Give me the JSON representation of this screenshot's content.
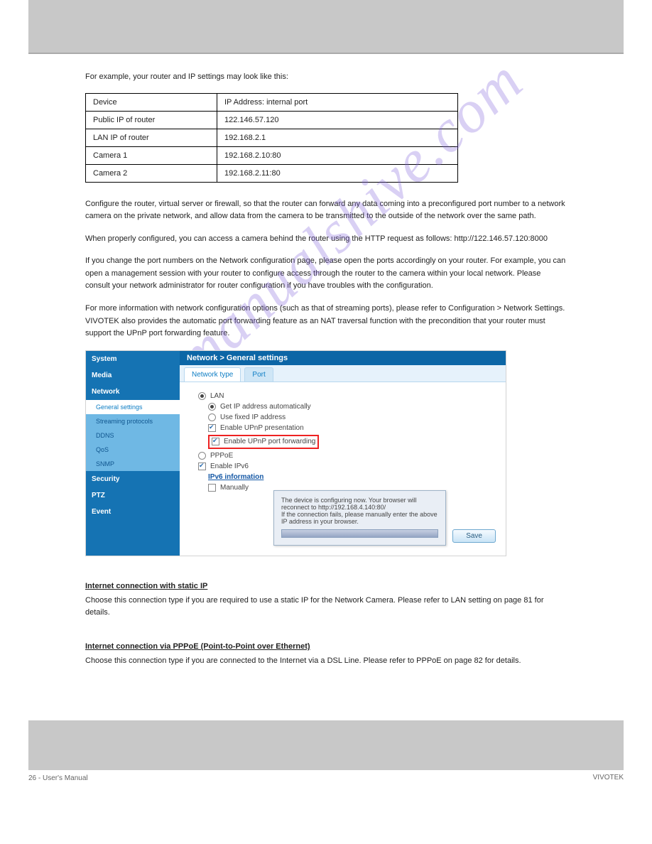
{
  "intro": "For example, your router and IP settings may look like this:",
  "table": {
    "rows": [
      [
        "Device",
        "IP Address: internal port"
      ],
      [
        "Public IP of router",
        "122.146.57.120"
      ],
      [
        "LAN IP of router",
        "192.168.2.1"
      ],
      [
        "Camera 1",
        "192.168.2.10:80"
      ],
      [
        "Camera 2",
        "192.168.2.11:80"
      ]
    ]
  },
  "para1": "Configure the router, virtual server or firewall, so that the router can forward any data coming into a preconfigured port number to a network camera on the private network, and allow data from the camera to be transmitted to the outside of the network over the same path.",
  "para2": "When properly configured, you can access a camera behind the router using the HTTP request as follows: http://122.146.57.120:8000",
  "para3": "If you change the port numbers on the Network configuration page, please open the ports accordingly on your router. For example, you can open a management session with your router to configure access through the router to the camera within your local network. Please consult your network administrator for router configuration if you have troubles with the configuration.",
  "para4": "For more information with network configuration options (such as that of streaming ports), please refer to Configuration > Network Settings. VIVOTEK also provides the automatic port forwarding feature as an NAT traversal function with the precondition that your router must support the UPnP port forwarding feature.",
  "screenshot": {
    "crumb": "Network  >  General settings",
    "sidebar": {
      "items": [
        "System",
        "Media",
        "Network",
        "Security",
        "PTZ",
        "Event"
      ],
      "subitems": [
        "General settings",
        "Streaming protocols",
        "DDNS",
        "QoS",
        "SNMP"
      ]
    },
    "tabs": [
      "Network type",
      "Port"
    ],
    "options": {
      "lan": "LAN",
      "get_ip": "Get IP address automatically",
      "fixed_ip": "Use fixed IP address",
      "upnp_present": "Enable UPnP presentation",
      "upnp_forward": "Enable UPnP port forwarding",
      "pppoe": "PPPoE",
      "ipv6": "Enable IPv6",
      "ipv6_info": "IPv6 information",
      "manually": "Manually"
    },
    "popup": {
      "line1": "The device is configuring now. Your browser will reconnect to http://192.168.4.140:80/",
      "line2": "If the connection fails, please manually enter the above IP address in your browser."
    },
    "save": "Save"
  },
  "internet_heading": "Internet connection with static IP",
  "internet_text": "Choose this connection type if you are required to use a static IP for the Network Camera. Please refer to LAN setting on page 81 for details.",
  "pppoe_heading": "Internet connection via PPPoE (Point-to-Point over Ethernet)",
  "pppoe_text": "Choose this connection type if you are connected to the Internet via a DSL Line. Please refer to PPPoE on page 82 for details.",
  "watermark": "manualshive.com",
  "page_num": "26 - User's Manual",
  "firmware": "VIVOTEK"
}
